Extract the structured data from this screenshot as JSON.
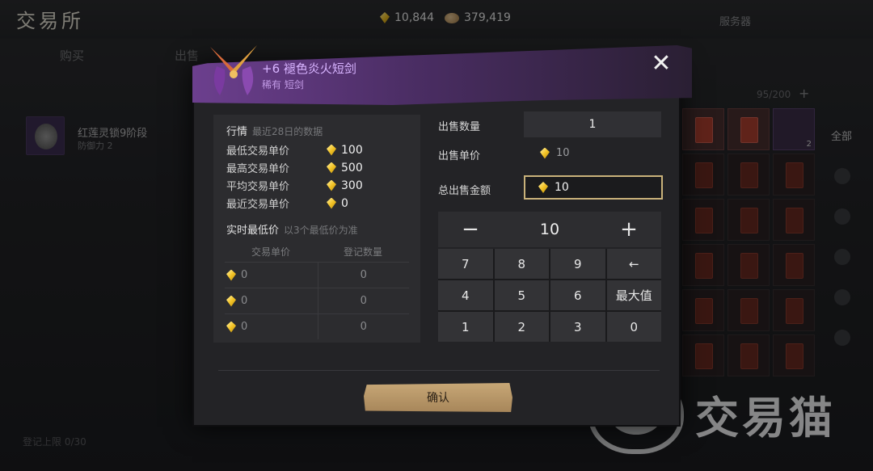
{
  "app": {
    "title": "交易所"
  },
  "currency": {
    "gold": "10,844",
    "coin": "379,419"
  },
  "header_buttons": {
    "server": "服务器",
    "other": "出售"
  },
  "bg_tabs": [
    "购买",
    "出售"
  ],
  "bg_listing": {
    "name": "红莲灵锁9阶段",
    "sub": "防御力 2"
  },
  "inventory": {
    "count": "95/200",
    "stack_count": "2",
    "filter_all": "全部"
  },
  "bg_footer": "登记上限 0/30",
  "modal": {
    "item_name": "+6 褪色炎火短剑",
    "item_sub": "稀有 短剑",
    "close": "✕",
    "market": {
      "title": "行情",
      "hint": "最近28日的数据",
      "stats": [
        {
          "label": "最低交易单价",
          "value": "100"
        },
        {
          "label": "最高交易单价",
          "value": "500"
        },
        {
          "label": "平均交易单价",
          "value": "300"
        },
        {
          "label": "最近交易单价",
          "value": "0"
        }
      ],
      "realtime_title": "实时最低价",
      "realtime_hint": "以3个最低价为准",
      "table_headers": [
        "交易单价",
        "登记数量"
      ],
      "rows": [
        {
          "price": "0",
          "qty": "0"
        },
        {
          "price": "0",
          "qty": "0"
        },
        {
          "price": "0",
          "qty": "0"
        }
      ]
    },
    "form": {
      "qty_label": "出售数量",
      "qty_value": "1",
      "unit_label": "出售单价",
      "unit_value": "10",
      "total_label": "总出售金额",
      "total_value": "10"
    },
    "keypad": {
      "minus": "−",
      "value": "10",
      "plus": "+",
      "keys": [
        "7",
        "8",
        "9",
        "←",
        "4",
        "5",
        "6",
        "最大值",
        "1",
        "2",
        "3",
        "0"
      ]
    },
    "confirm": "确认"
  },
  "watermark": "交易猫",
  "colors": {
    "accent_gold": "#f3c326",
    "rare_purple": "#d8b4ff",
    "confirm_bg": "#b8976a"
  }
}
